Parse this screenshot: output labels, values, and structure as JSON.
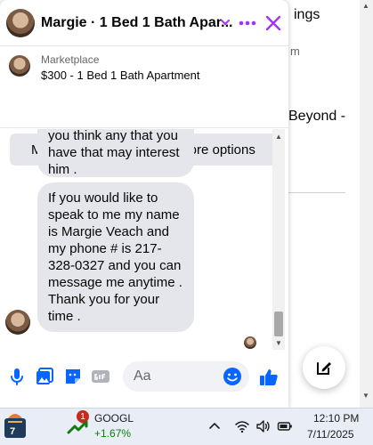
{
  "background": {
    "fragment1": "ings",
    "fragment2": "m",
    "fragment3": "Beyond -"
  },
  "chat": {
    "title": "Margie · 1 Bed 1 Bath Apar...",
    "product": {
      "source": "Marketplace",
      "listing": "$300 - 1 Bed 1 Bath Apartment"
    },
    "buttons": {
      "pending": "Mark as pending",
      "more": "More options"
    },
    "messages": [
      {
        "lines": [
          "you think any that you",
          "have that may interest",
          "him ."
        ]
      },
      {
        "lines": [
          "If you would like to",
          "speak to me my name",
          "is Margie Veach and",
          "my phone # is 217-",
          "328-0327 and you can",
          "message me anytime .",
          "Thank you for your",
          "time ."
        ]
      }
    ],
    "composer": {
      "placeholder": "Aa"
    },
    "accent": "#a033ff",
    "messenger_blue": "#0866ff"
  },
  "taskbar": {
    "app_badge": "7",
    "stock": {
      "badge": "1",
      "ticker": "GOOGL",
      "change": "+1.67%"
    },
    "time": "12:10 PM",
    "date": "7/11/2025"
  }
}
